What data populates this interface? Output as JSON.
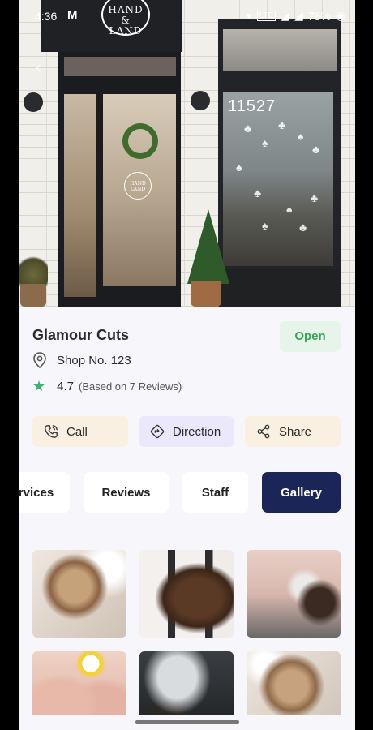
{
  "status_bar": {
    "time": "4:36",
    "battery": "78%",
    "network": "LTE"
  },
  "hero": {
    "sign_text": "HAND & LAND",
    "address_number": "11527"
  },
  "shop": {
    "name": "Glamour Cuts",
    "status": "Open",
    "address": "Shop No. 123",
    "rating": "4.7",
    "reviews_text": "(Based on 7 Reviews)"
  },
  "actions": {
    "call": "Call",
    "direction": "Direction",
    "share": "Share"
  },
  "tabs": [
    {
      "label": "rvices"
    },
    {
      "label": "Reviews"
    },
    {
      "label": "Staff"
    },
    {
      "label": "Gallery"
    }
  ],
  "colors": {
    "accent": "#1c2557",
    "open_green": "#3aa45a",
    "star_green": "#3bb273"
  }
}
